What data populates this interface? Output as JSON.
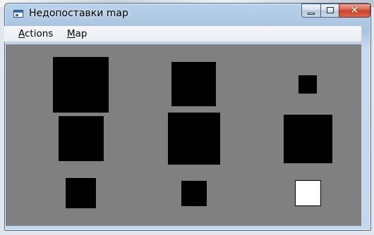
{
  "window": {
    "title": "Недопоставки map"
  },
  "caption_buttons": {
    "minimize_icon": "minimize-icon",
    "maximize_icon": "maximize-icon",
    "close_glyph": "✕"
  },
  "menu": {
    "items": [
      {
        "accel": "A",
        "rest": "ctions"
      },
      {
        "accel": "M",
        "rest": "ap"
      }
    ]
  },
  "map": {
    "background": "#808080",
    "cells": [
      {
        "state": "filled",
        "color": "#000000"
      },
      {
        "state": "filled",
        "color": "#000000"
      },
      {
        "state": "filled",
        "color": "#000000"
      },
      {
        "state": "filled",
        "color": "#000000"
      },
      {
        "state": "filled",
        "color": "#000000"
      },
      {
        "state": "filled",
        "color": "#000000"
      },
      {
        "state": "filled",
        "color": "#000000"
      },
      {
        "state": "filled",
        "color": "#000000"
      },
      {
        "state": "empty",
        "color": "#ffffff"
      }
    ]
  }
}
